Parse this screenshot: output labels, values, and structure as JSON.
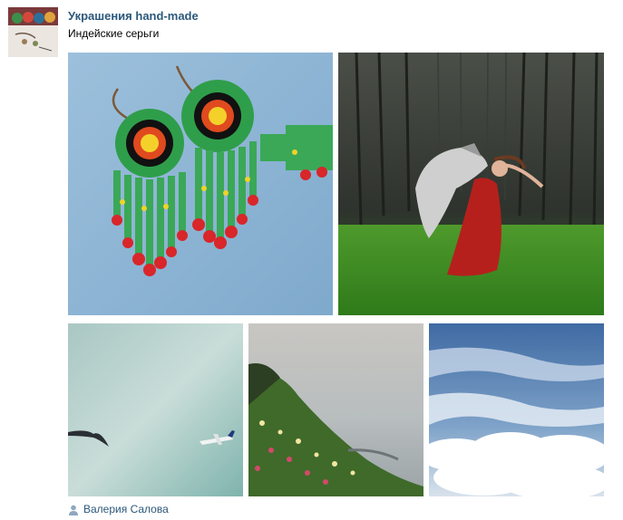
{
  "post": {
    "group_name": "Украшения hand-made",
    "text": "Индейские серьги",
    "author": "Валерия Салова"
  },
  "photos": [
    {
      "name": "photo-beaded-earrings",
      "subject": "beaded earrings"
    },
    {
      "name": "photo-wolf-and-woman",
      "subject": "wolf and woman in red dress"
    },
    {
      "name": "photo-birds-and-plane",
      "subject": "birds and airplane in sky"
    },
    {
      "name": "photo-coast-flowers",
      "subject": "flowers on sea cliff"
    },
    {
      "name": "photo-clouds",
      "subject": "clouds from above"
    }
  ],
  "icons": {
    "author_icon": "user-icon"
  },
  "colors": {
    "link": "#2b587a",
    "text": "#000000",
    "icon": "#8ea7c0"
  }
}
